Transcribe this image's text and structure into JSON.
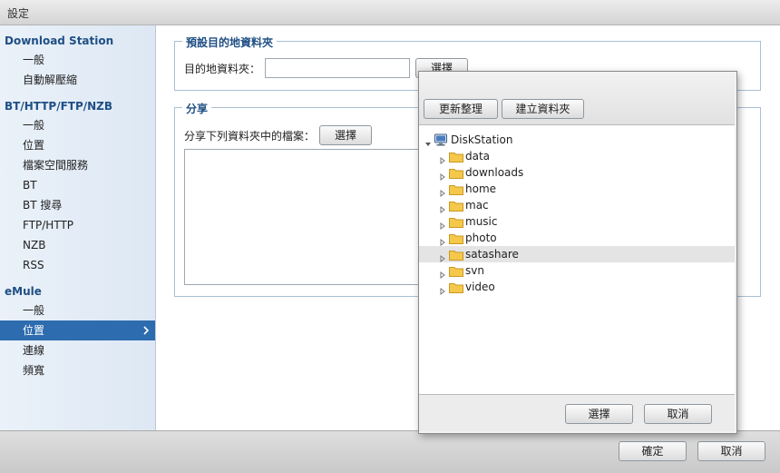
{
  "window": {
    "title": "設定"
  },
  "sidebar": {
    "sections": [
      {
        "title": "Download Station",
        "items": [
          "一般",
          "自動解壓縮"
        ]
      },
      {
        "title": "BT/HTTP/FTP/NZB",
        "items": [
          "一般",
          "位置",
          "檔案空間服務",
          "BT",
          "BT 搜尋",
          "FTP/HTTP",
          "NZB",
          "RSS"
        ]
      },
      {
        "title": "eMule",
        "items": [
          "一般",
          "位置",
          "連線",
          "頻寬"
        ]
      }
    ],
    "active": "eMule/位置"
  },
  "main": {
    "destination": {
      "legend": "預設目的地資料夾",
      "label": "目的地資料夾：",
      "value": "",
      "button": "選擇"
    },
    "share": {
      "legend": "分享",
      "label": "分享下列資料夾中的檔案：",
      "button": "選擇"
    }
  },
  "footer": {
    "ok": "確定",
    "cancel": "取消"
  },
  "folder_picker": {
    "refresh": "更新整理",
    "create": "建立資料夾",
    "root": "DiskStation",
    "folders": [
      "data",
      "downloads",
      "home",
      "mac",
      "music",
      "photo",
      "satashare",
      "svn",
      "video"
    ],
    "selected": "satashare",
    "select": "選擇",
    "cancel": "取消"
  },
  "colors": {
    "accent": "#2d6cae",
    "heading": "#1f4f84",
    "folder": "#f5c84c"
  }
}
